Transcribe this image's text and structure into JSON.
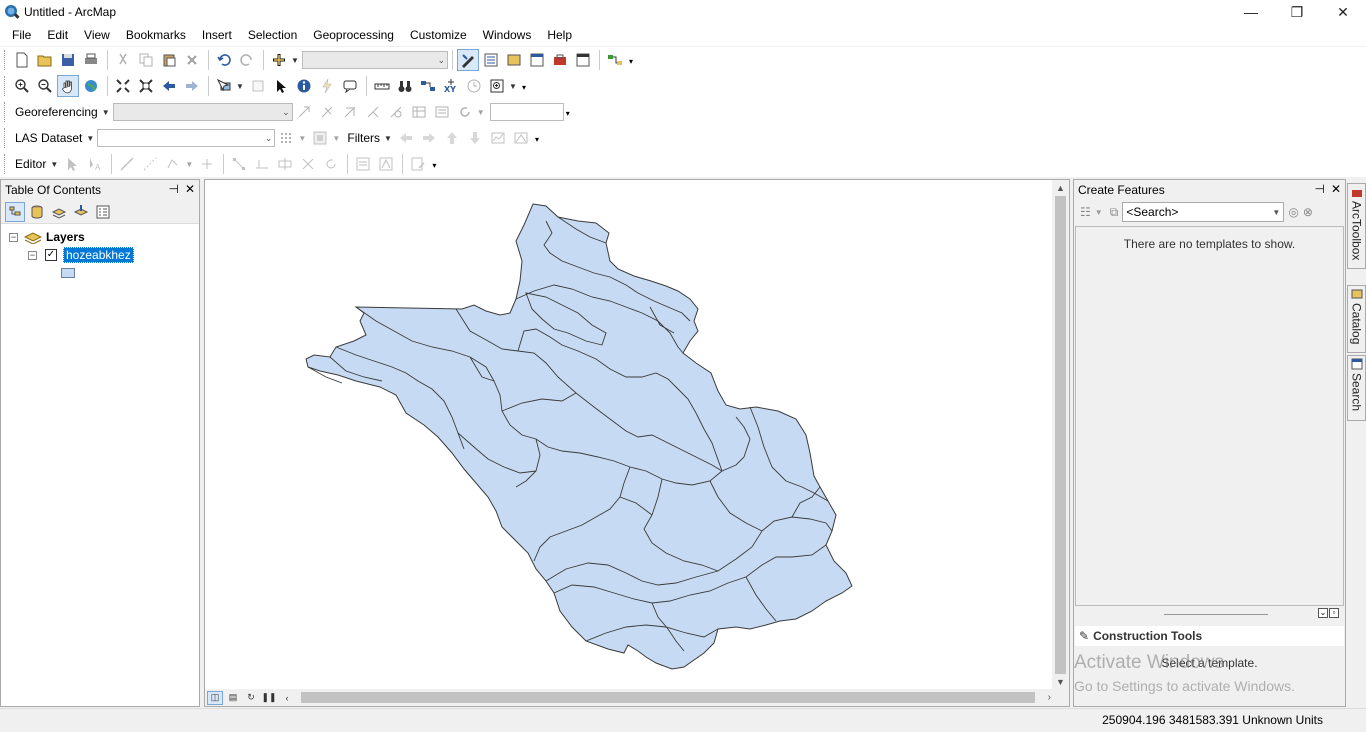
{
  "window": {
    "title": "Untitled - ArcMap",
    "app_icon": "arcmap-globe-icon",
    "minimize_glyph": "—",
    "restore_glyph": "❐",
    "close_glyph": "✕"
  },
  "menubar": {
    "items": [
      "File",
      "Edit",
      "View",
      "Bookmarks",
      "Insert",
      "Selection",
      "Geoprocessing",
      "Customize",
      "Windows",
      "Help"
    ]
  },
  "toolbars": {
    "georeferencing_label": "Georeferencing",
    "las_dataset_label": "LAS Dataset",
    "filters_label": "Filters",
    "editor_label": "Editor",
    "scale_value": ""
  },
  "toc": {
    "title": "Table Of Contents",
    "root_label": "Layers",
    "layer_name": "hozeabkhez",
    "layer_checked": true,
    "pin_glyph": "📌",
    "close_glyph": "✕"
  },
  "create_features": {
    "title": "Create Features",
    "search_placeholder": "<Search>",
    "empty_message": "There are no templates to show.",
    "construction_tools_label": "Construction Tools",
    "select_template_message": "Select a template."
  },
  "side_tabs": [
    "ArcToolbox",
    "Catalog",
    "Search"
  ],
  "watermark": {
    "line1": "Activate Windows",
    "line2": "Go to Settings to activate Windows."
  },
  "status": {
    "x": "250904.196",
    "y": "3481583.391",
    "units": "Unknown Units"
  },
  "colors": {
    "polygon_fill": "#c6dbf3",
    "polygon_stroke": "#3a3a3a",
    "selection_blue": "#0078d7"
  }
}
